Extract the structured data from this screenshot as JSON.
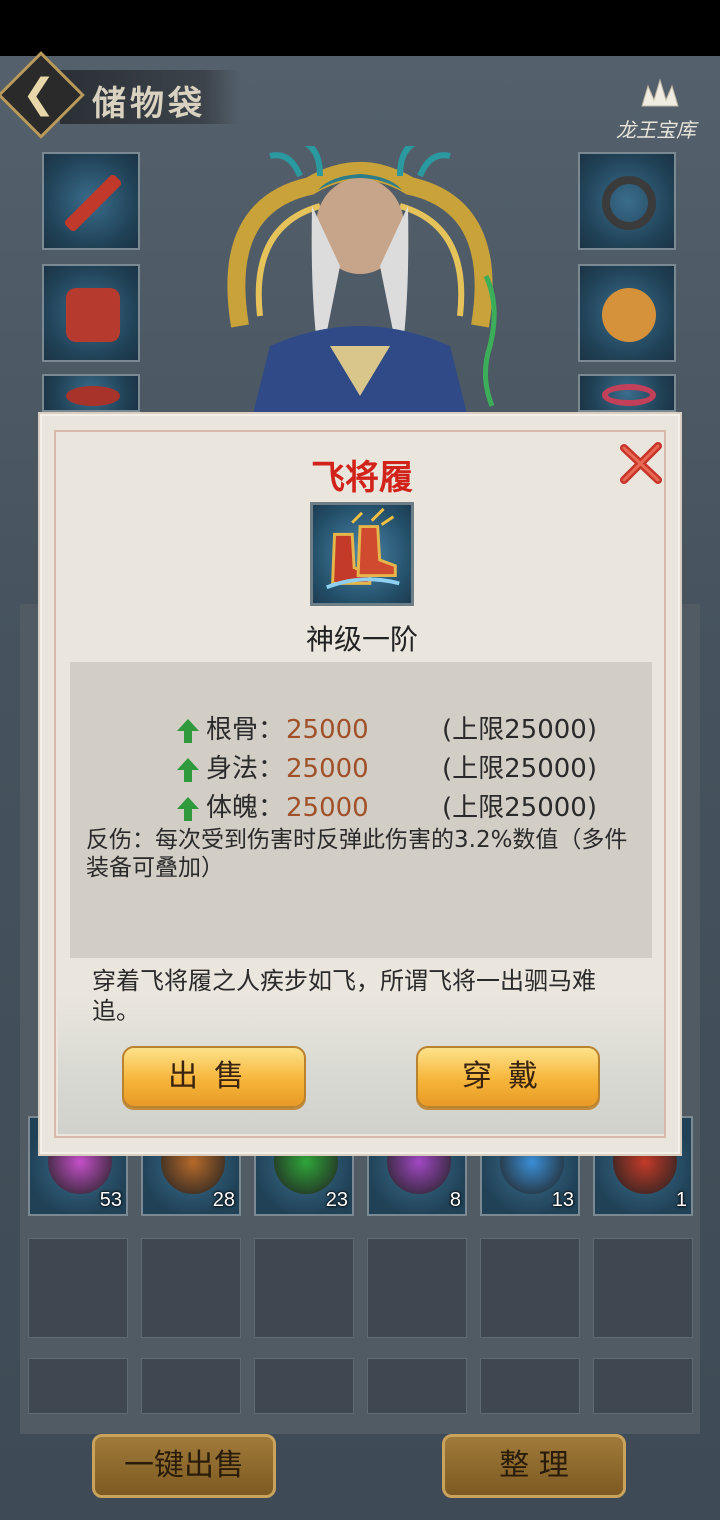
{
  "header": {
    "title": "储物袋",
    "logo_text": "龙王宝库"
  },
  "equip_slots_left": [
    {
      "icon": "sword-icon",
      "color": "#c0392b"
    },
    {
      "icon": "armor-icon",
      "color": "#b73a2f"
    },
    {
      "icon": "helmet-icon",
      "color": "#a8332a"
    }
  ],
  "equip_slots_right": [
    {
      "icon": "ring-icon",
      "color": "#3b3b3b"
    },
    {
      "icon": "amulet-icon",
      "color": "#d6923a"
    },
    {
      "icon": "bracelet-icon",
      "color": "#c2405a"
    }
  ],
  "inventory": {
    "row_items": [
      {
        "icon": "pink-gem-icon",
        "color": "#c44fc8",
        "count": "53"
      },
      {
        "icon": "orange-gem-icon",
        "color": "#b66a2a",
        "count": "28"
      },
      {
        "icon": "green-gem-icon",
        "color": "#2fa53a",
        "count": "23"
      },
      {
        "icon": "purple-gem-icon",
        "color": "#a048c4",
        "count": "8"
      },
      {
        "icon": "blue-gem-icon",
        "color": "#3a8fd6",
        "count": "13"
      },
      {
        "icon": "boots-icon",
        "color": "#c33a28",
        "count": "1"
      }
    ]
  },
  "bottom_buttons": {
    "sell_all": "一键出售",
    "sort": "整 理"
  },
  "modal": {
    "item_name": "飞将履",
    "item_grade": "神级一阶",
    "stats": [
      {
        "label": "根骨：",
        "value": "25000",
        "cap": "(上限25000)"
      },
      {
        "label": "身法：",
        "value": "25000",
        "cap": "(上限25000)"
      },
      {
        "label": "体魄：",
        "value": "25000",
        "cap": "(上限25000)"
      }
    ],
    "effect": "反伤：每次受到伤害时反弹此伤害的3.2%数值（多件装备可叠加）",
    "flavor": "穿着飞将履之人疾步如飞，所谓飞将一出驷马难追。",
    "sell_label": "出售",
    "equip_label": "穿戴",
    "accent_color": "#d2231a",
    "stat_value_color": "#a0512a",
    "arrow_color": "#2e9a3c"
  }
}
